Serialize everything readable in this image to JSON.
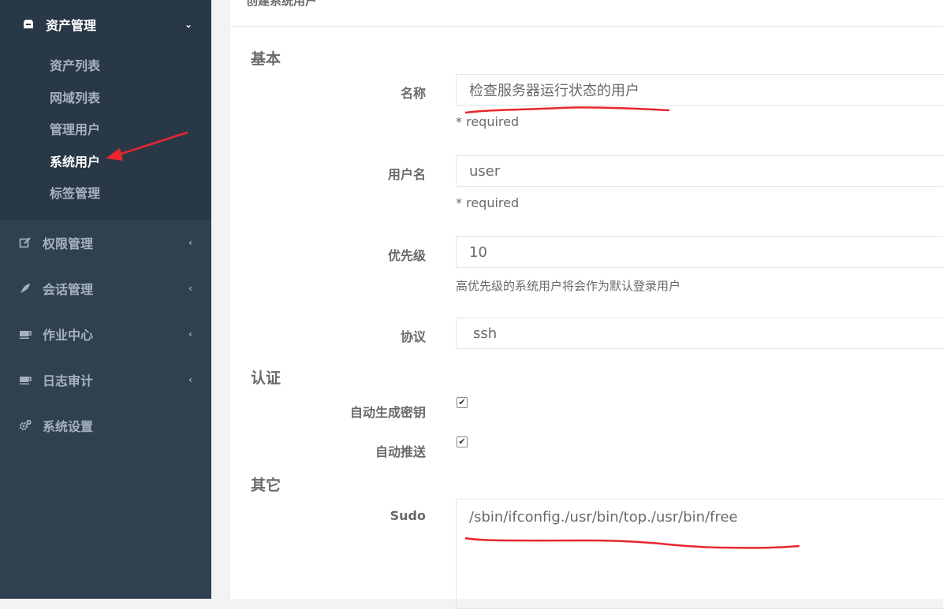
{
  "sidebar": {
    "asset_menu": {
      "label": "资产管理",
      "sub_items": [
        "资产列表",
        "网域列表",
        "管理用户",
        "系统用户",
        "标签管理"
      ]
    },
    "menus": [
      {
        "label": "权限管理",
        "icon": "edit-icon"
      },
      {
        "label": "会话管理",
        "icon": "rocket-icon"
      },
      {
        "label": "作业中心",
        "icon": "coffee-icon"
      },
      {
        "label": "日志审计",
        "icon": "coffee-icon"
      },
      {
        "label": "系统设置",
        "icon": "gears-icon"
      }
    ]
  },
  "form": {
    "title": "创建系统用户",
    "sections": {
      "basic": "基本",
      "auth": "认证",
      "other": "其它"
    },
    "name": {
      "label": "名称",
      "value": "检查服务器运行状态的用户",
      "help": "* required"
    },
    "username": {
      "label": "用户名",
      "value": "user",
      "help": "* required"
    },
    "priority": {
      "label": "优先级",
      "value": "10",
      "help": "高优先级的系统用户将会作为默认登录用户"
    },
    "protocol": {
      "label": "协议",
      "value": "ssh"
    },
    "auto_generate_key": {
      "label": "自动生成密钥",
      "checked": true
    },
    "auto_push": {
      "label": "自动推送",
      "checked": true
    },
    "sudo": {
      "label": "Sudo",
      "value": "/sbin/ifconfig./usr/bin/top./usr/bin/free"
    }
  },
  "colors": {
    "sidebar_bg": "#2f4050",
    "annotation_red": "#e8262b"
  }
}
